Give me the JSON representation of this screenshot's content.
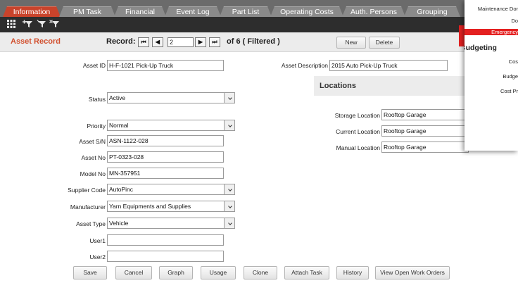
{
  "tabs": [
    {
      "label": "Information",
      "active": true
    },
    {
      "label": "PM Task"
    },
    {
      "label": "Financial"
    },
    {
      "label": "Event Log"
    },
    {
      "label": "Part List"
    },
    {
      "label": "Operating Costs"
    },
    {
      "label": "Auth. Persons"
    },
    {
      "label": "Grouping"
    }
  ],
  "toolbar": {
    "icons": [
      "grid-icon",
      "filter-add-icon",
      "filter-icon",
      "filter-remove-icon"
    ]
  },
  "record_bar": {
    "title": "Asset Record",
    "record_label": "Record:",
    "first_glyph": "⏮",
    "prev_glyph": "◀",
    "next_glyph": "▶",
    "last_glyph": "⏭",
    "current": "2",
    "of_text": "of 6 ( Filtered )",
    "new_label": "New",
    "delete_label": "Delete"
  },
  "fields": {
    "asset_id": {
      "label": "Asset ID",
      "value": "H-F-1021 Pick-Up Truck"
    },
    "asset_description": {
      "label": "Asset Description",
      "value": "2015 Auto Pick-Up Truck"
    },
    "status": {
      "label": "Status",
      "value": "Active"
    },
    "priority": {
      "label": "Priority",
      "value": "Normal"
    },
    "asset_sn": {
      "label": "Asset S/N",
      "value": "ASN-1122-028"
    },
    "asset_no": {
      "label": "Asset No",
      "value": "PT-0323-028"
    },
    "model_no": {
      "label": "Model No",
      "value": "MN-357951"
    },
    "supplier_code": {
      "label": "Supplier Code",
      "value": "AutoPinc"
    },
    "manufacturer": {
      "label": "Manufacturer",
      "value": "Yarn Equipments and Supplies"
    },
    "asset_type": {
      "label": "Asset Type",
      "value": "Vehicle"
    },
    "user1": {
      "label": "User1",
      "value": ""
    },
    "user2": {
      "label": "User2",
      "value": ""
    }
  },
  "locations": {
    "title": "Locations",
    "storage": {
      "label": "Storage Location",
      "value": "Rooftop Garage"
    },
    "current": {
      "label": "Current Location",
      "value": "Rooftop Garage"
    },
    "manual": {
      "label": "Manual Location",
      "value": "Rooftop Garage"
    }
  },
  "overlay": {
    "line1": "Maintenance Dor",
    "line2": "Do",
    "emergency": "Emergency",
    "budgeting": "Budgeting",
    "cost": "Cos",
    "budget": "Budge",
    "cost_pr": "Cost Pr",
    "accent": "#e42020"
  },
  "footer_buttons": [
    "Save",
    "Cancel",
    "Graph",
    "Usage",
    "Clone",
    "Attach Task",
    "History",
    "View Open Work Orders"
  ],
  "colors": {
    "active_tab": "#c9432b",
    "title_accent": "#d2502f"
  }
}
